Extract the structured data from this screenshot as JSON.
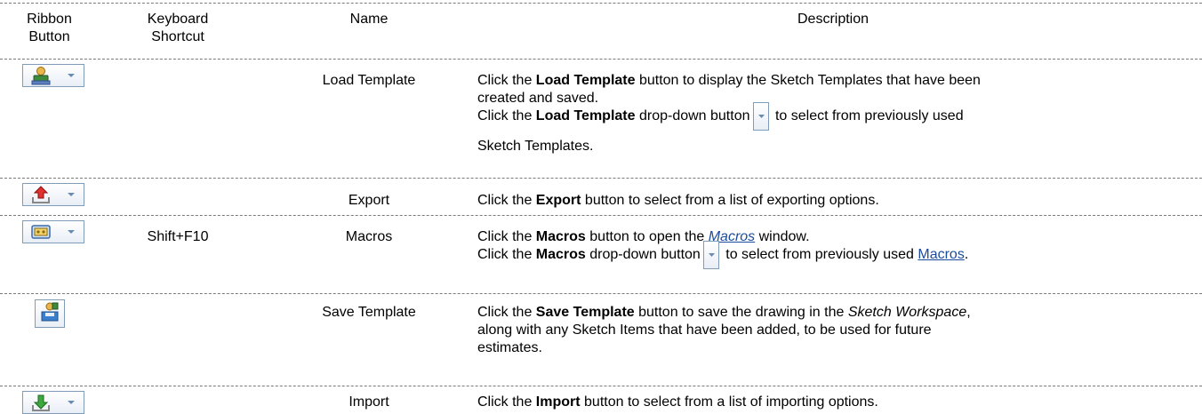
{
  "header": {
    "col_ribbon": [
      "Ribbon",
      "Button"
    ],
    "col_shortcut": [
      "Keyboard",
      "Shortcut"
    ],
    "col_name": "Name",
    "col_description": "Description"
  },
  "rows": [
    {
      "icon": "load-template-icon",
      "shortcut": "",
      "name": "Load Template",
      "d1_pre": "Click the ",
      "d1_bold": "Load Template",
      "d1_post": " button to display the Sketch Templates that have been",
      "d1_cont": "created and saved.",
      "d2_pre": "Click the ",
      "d2_bold": "Load Template",
      "d2_mid": " drop-down button",
      "d2_post": " to select from previously used",
      "d2_cont": "Sketch Templates."
    },
    {
      "icon": "export-icon",
      "shortcut": "",
      "name": "Export",
      "d1_pre": "Click the ",
      "d1_bold": "Export",
      "d1_post": " button to select from a list of exporting options."
    },
    {
      "icon": "macros-icon",
      "shortcut": "Shift+F10",
      "name": "Macros",
      "d1_pre": "Click the ",
      "d1_bold": "Macros",
      "d1_mid": " button to open the ",
      "d1_link": "Macros",
      "d1_post": " window.",
      "d2_pre": "Click the ",
      "d2_bold": "Macros",
      "d2_mid": " drop-down button",
      "d2_post": " to select from previously used ",
      "d2_link": "Macros",
      "d2_end": "."
    },
    {
      "icon": "save-template-icon",
      "shortcut": "",
      "name": "Save Template",
      "d1_pre": "Click the ",
      "d1_bold": "Save Template",
      "d1_mid": " button to save the drawing in the ",
      "d1_ital": "Sketch Workspace",
      "d1_post": ",",
      "d1_cont": "along with any Sketch Items that have been added, to be used for future",
      "d1_cont2": "estimates."
    },
    {
      "icon": "import-icon",
      "shortcut": "",
      "name": "Import",
      "d1_pre": "Click the ",
      "d1_bold": "Import",
      "d1_post": " button to select from a list of importing options."
    }
  ],
  "colors": {
    "link": "#1a4b9c",
    "border": "#7f9db9",
    "rule": "#7a7a7a"
  }
}
